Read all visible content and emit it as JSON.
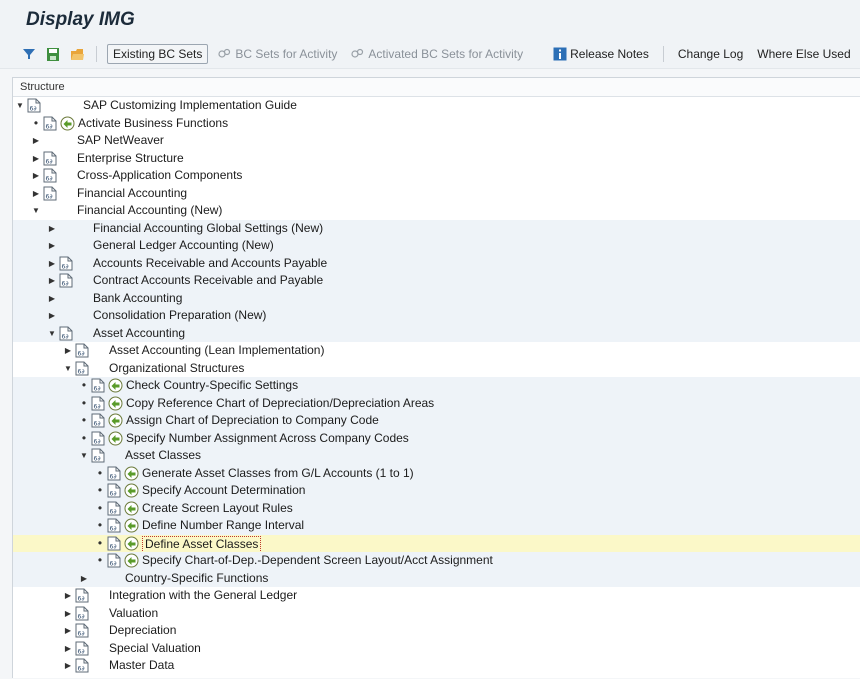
{
  "title": "Display IMG",
  "toolbar": {
    "icons": [
      "filter-icon",
      "save-variant-icon",
      "folder-icon"
    ],
    "existing_bc_sets": "Existing BC Sets",
    "bc_sets_for_activity": "BC Sets for Activity",
    "activated_bc_sets": "Activated BC Sets for Activity",
    "release_notes": "Release Notes",
    "change_log": "Change Log",
    "where_else_used": "Where Else Used"
  },
  "structure_header": "Structure",
  "tree": [
    {
      "label": "SAP Customizing Implementation Guide",
      "level": 0,
      "marker": "down",
      "doc": true,
      "activity": false
    },
    {
      "label": "Activate Business Functions",
      "level": 1,
      "marker": "dot",
      "doc": true,
      "activity": true
    },
    {
      "label": "SAP NetWeaver",
      "level": 1,
      "marker": "right",
      "doc": false,
      "activity": false
    },
    {
      "label": "Enterprise Structure",
      "level": 1,
      "marker": "right",
      "doc": true,
      "activity": false
    },
    {
      "label": "Cross-Application Components",
      "level": 1,
      "marker": "right",
      "doc": true,
      "activity": false
    },
    {
      "label": "Financial Accounting",
      "level": 1,
      "marker": "right",
      "doc": true,
      "activity": false
    },
    {
      "label": "Financial Accounting (New)",
      "level": 1,
      "marker": "down",
      "doc": false,
      "activity": false
    },
    {
      "label": "Financial Accounting Global Settings (New)",
      "level": 2,
      "marker": "right",
      "doc": false,
      "activity": false
    },
    {
      "label": "General Ledger Accounting (New)",
      "level": 2,
      "marker": "right",
      "doc": false,
      "activity": false
    },
    {
      "label": "Accounts Receivable and Accounts Payable",
      "level": 2,
      "marker": "right",
      "doc": true,
      "activity": false
    },
    {
      "label": "Contract Accounts Receivable and Payable",
      "level": 2,
      "marker": "right",
      "doc": true,
      "activity": false
    },
    {
      "label": "Bank Accounting",
      "level": 2,
      "marker": "right",
      "doc": false,
      "activity": false
    },
    {
      "label": "Consolidation Preparation (New)",
      "level": 2,
      "marker": "right",
      "doc": false,
      "activity": false
    },
    {
      "label": "Asset Accounting",
      "level": 2,
      "marker": "down",
      "doc": true,
      "activity": false
    },
    {
      "label": "Asset Accounting (Lean Implementation)",
      "level": 3,
      "marker": "right",
      "doc": true,
      "activity": false
    },
    {
      "label": "Organizational Structures",
      "level": 3,
      "marker": "down",
      "doc": true,
      "activity": false
    },
    {
      "label": "Check Country-Specific Settings",
      "level": 4,
      "marker": "dot",
      "doc": true,
      "activity": true
    },
    {
      "label": "Copy Reference Chart of Depreciation/Depreciation Areas",
      "level": 4,
      "marker": "dot",
      "doc": true,
      "activity": true
    },
    {
      "label": "Assign Chart of Depreciation to Company Code",
      "level": 4,
      "marker": "dot",
      "doc": true,
      "activity": true
    },
    {
      "label": "Specify Number Assignment Across Company Codes",
      "level": 4,
      "marker": "dot",
      "doc": true,
      "activity": true
    },
    {
      "label": "Asset Classes",
      "level": 4,
      "marker": "down",
      "doc": true,
      "activity": false
    },
    {
      "label": "Generate Asset Classes from G/L Accounts (1 to 1)",
      "level": 5,
      "marker": "dot",
      "doc": true,
      "activity": true
    },
    {
      "label": "Specify Account Determination",
      "level": 5,
      "marker": "dot",
      "doc": true,
      "activity": true
    },
    {
      "label": "Create Screen Layout Rules",
      "level": 5,
      "marker": "dot",
      "doc": true,
      "activity": true
    },
    {
      "label": "Define Number Range Interval",
      "level": 5,
      "marker": "dot",
      "doc": true,
      "activity": true
    },
    {
      "label": "Define Asset Classes",
      "level": 5,
      "marker": "dot",
      "doc": true,
      "activity": true,
      "selected": true
    },
    {
      "label": "Specify Chart-of-Dep.-Dependent Screen Layout/Acct Assignment",
      "level": 5,
      "marker": "dot",
      "doc": true,
      "activity": true
    },
    {
      "label": "Country-Specific Functions",
      "level": 4,
      "marker": "right",
      "doc": false,
      "activity": false
    },
    {
      "label": "Integration with the General Ledger",
      "level": 3,
      "marker": "right",
      "doc": true,
      "activity": false
    },
    {
      "label": "Valuation",
      "level": 3,
      "marker": "right",
      "doc": true,
      "activity": false
    },
    {
      "label": "Depreciation",
      "level": 3,
      "marker": "right",
      "doc": true,
      "activity": false
    },
    {
      "label": "Special Valuation",
      "level": 3,
      "marker": "right",
      "doc": true,
      "activity": false
    },
    {
      "label": "Master Data",
      "level": 3,
      "marker": "right",
      "doc": true,
      "activity": false
    }
  ]
}
